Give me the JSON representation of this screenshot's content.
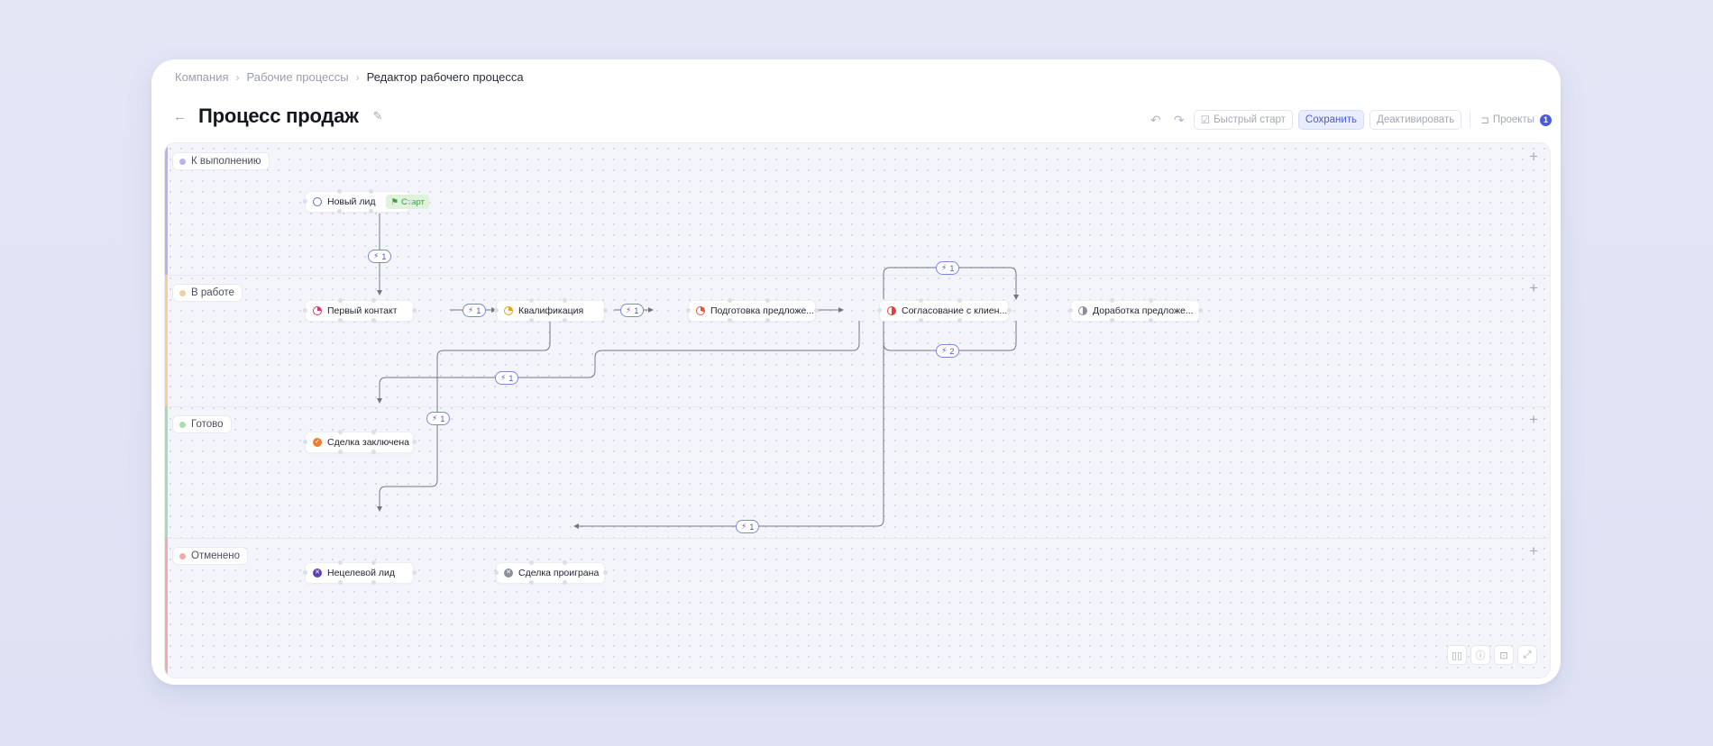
{
  "breadcrumb": [
    "Компания",
    "Рабочие процессы",
    "Редактор рабочего процесса"
  ],
  "title": "Процесс продаж",
  "toolbar": {
    "quick_start": "Быстрый старт",
    "save": "Сохранить",
    "deactivate": "Деактивировать",
    "projects": "Проекты",
    "projects_count": "1"
  },
  "lanes": [
    {
      "label": "К выполнению",
      "color": "#b9b0ec"
    },
    {
      "label": "В работе",
      "color": "#f0cf9a"
    },
    {
      "label": "Готово",
      "color": "#a9dcad"
    },
    {
      "label": "Отменено",
      "color": "#f1a9a9"
    }
  ],
  "nodes": {
    "new_lead": "Новый лид",
    "start_badge": "Старт",
    "first_contact": "Первый контакт",
    "qualification": "Квалификация",
    "proposal_prep": "Подготовка предложе...",
    "client_approval": "Согласование с клиен...",
    "proposal_rework": "Доработка предложе...",
    "deal_won": "Сделка заключена",
    "non_target": "Нецелевой лид",
    "deal_lost": "Сделка проиграна"
  },
  "triggers": {
    "t_lead_contact": "1",
    "t_contact_qual": "1",
    "t_qual_prep": "1",
    "t_rework_top": "1",
    "t_rework_bottom": "2",
    "t_to_won": "1",
    "t_to_nontarget": "1",
    "t_to_lost": "1"
  },
  "icons": {
    "undo": "undo-icon",
    "redo": "redo-icon",
    "quick_start": "checklist-icon",
    "projects": "projects-icon",
    "trigger": "lightning-icon",
    "start": "flag-icon"
  },
  "colors": {
    "accent": "#4a5bd6",
    "edge": "#737683",
    "trigger_border": "#7b86e0"
  }
}
